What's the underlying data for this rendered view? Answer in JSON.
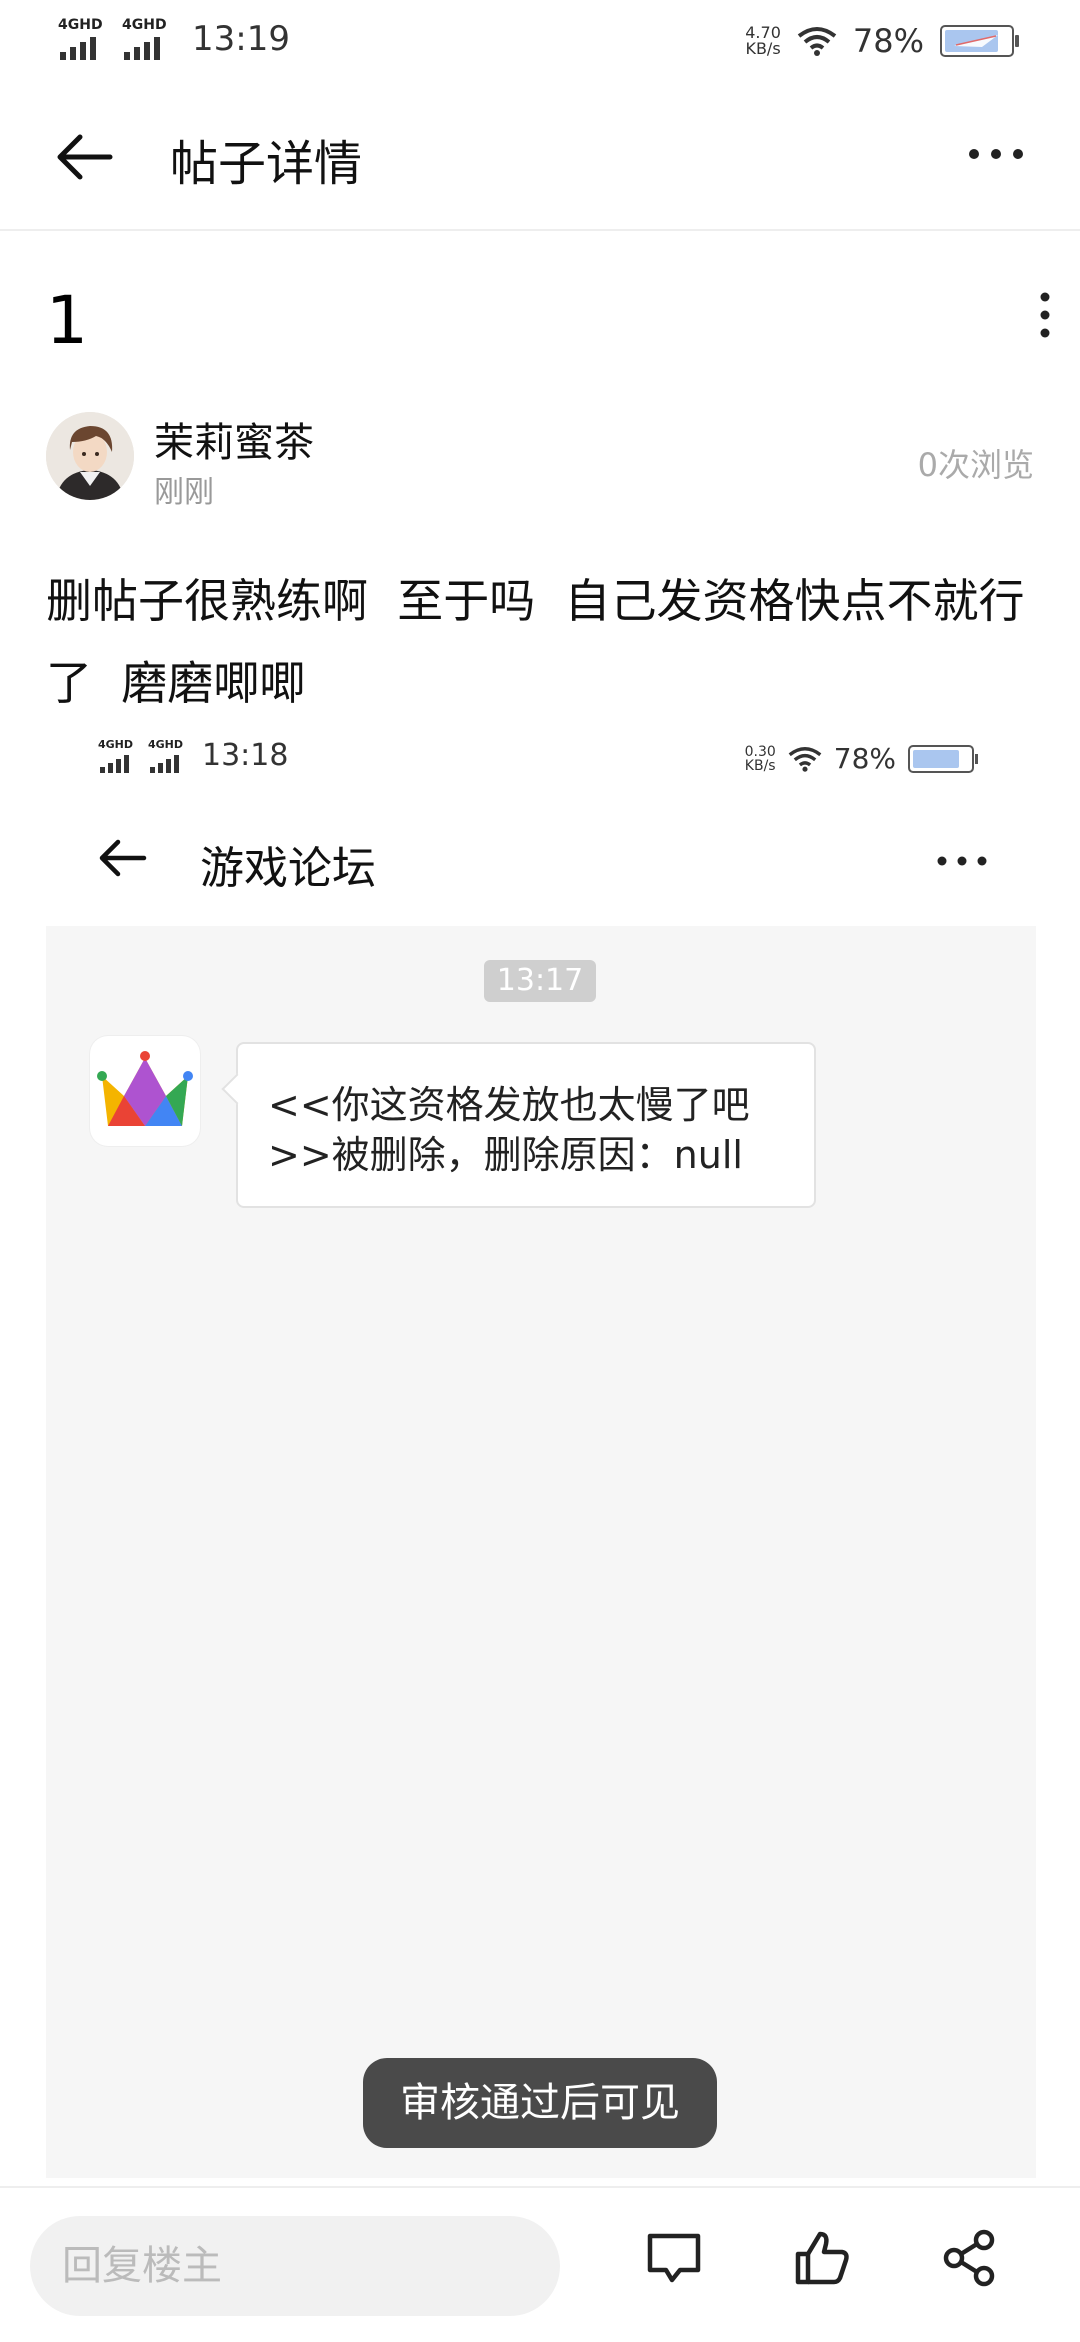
{
  "status_bar": {
    "signal1": "4GHD",
    "signal2": "4GHD",
    "time": "13:19",
    "speed_value": "4.70",
    "speed_unit": "KB/s",
    "battery": "78%"
  },
  "header": {
    "title": "帖子详情"
  },
  "post": {
    "title": "1",
    "author": "茉莉蜜茶",
    "time": "刚刚",
    "views": "0次浏览",
    "body": "删帖子很熟练啊  至于吗  自己发资格快点不就行了  磨磨唧唧"
  },
  "embedded_screenshot": {
    "status_bar": {
      "signal1": "4GHD",
      "signal2": "4GHD",
      "time": "13:18",
      "speed_value": "0.30",
      "speed_unit": "KB/s",
      "battery": "78%"
    },
    "header": {
      "title": "游戏论坛"
    },
    "chat": {
      "timestamp": "13:17",
      "message": "<<你这资格发放也太慢了吧\n>>被删除，删除原因：null"
    }
  },
  "toast": {
    "text": "审核通过后可见"
  },
  "bottom_bar": {
    "reply_placeholder": "回复楼主"
  },
  "icons": [
    "back-arrow-icon",
    "more-dots-icon",
    "vertical-dots-icon",
    "comment-icon",
    "like-icon",
    "share-icon",
    "wifi-icon",
    "battery-icon",
    "app-crown-icon"
  ],
  "colors": {
    "toast_bg": "#4a4a4a",
    "muted_text": "#999999",
    "chat_bg": "#f6f6f6"
  }
}
